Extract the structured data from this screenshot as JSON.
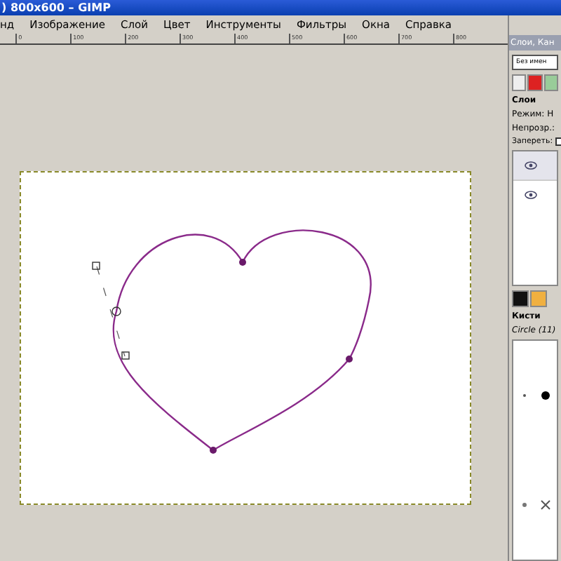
{
  "window": {
    "title": ") 800x600 – GIMP"
  },
  "menu": [
    "нд",
    "Изображение",
    "Слой",
    "Цвет",
    "Инструменты",
    "Фильтры",
    "Окна",
    "Справка"
  ],
  "ruler": [
    "0",
    "100",
    "200",
    "300",
    "400",
    "500",
    "600",
    "700",
    "800"
  ],
  "dock": {
    "title": "Слои, Кан",
    "image_field": "Без имен",
    "layers_title": "Слои",
    "mode_label": "Режим:",
    "mode_value": "Н",
    "opacity_label": "Непрозр.:",
    "lock_label": "Запереть:",
    "layers": [
      {
        "visible": true,
        "selected": true
      },
      {
        "visible": true,
        "selected": false
      }
    ],
    "brushes_title": "Кисти",
    "brush_name": "Circle (11)",
    "lock_checked": false
  }
}
